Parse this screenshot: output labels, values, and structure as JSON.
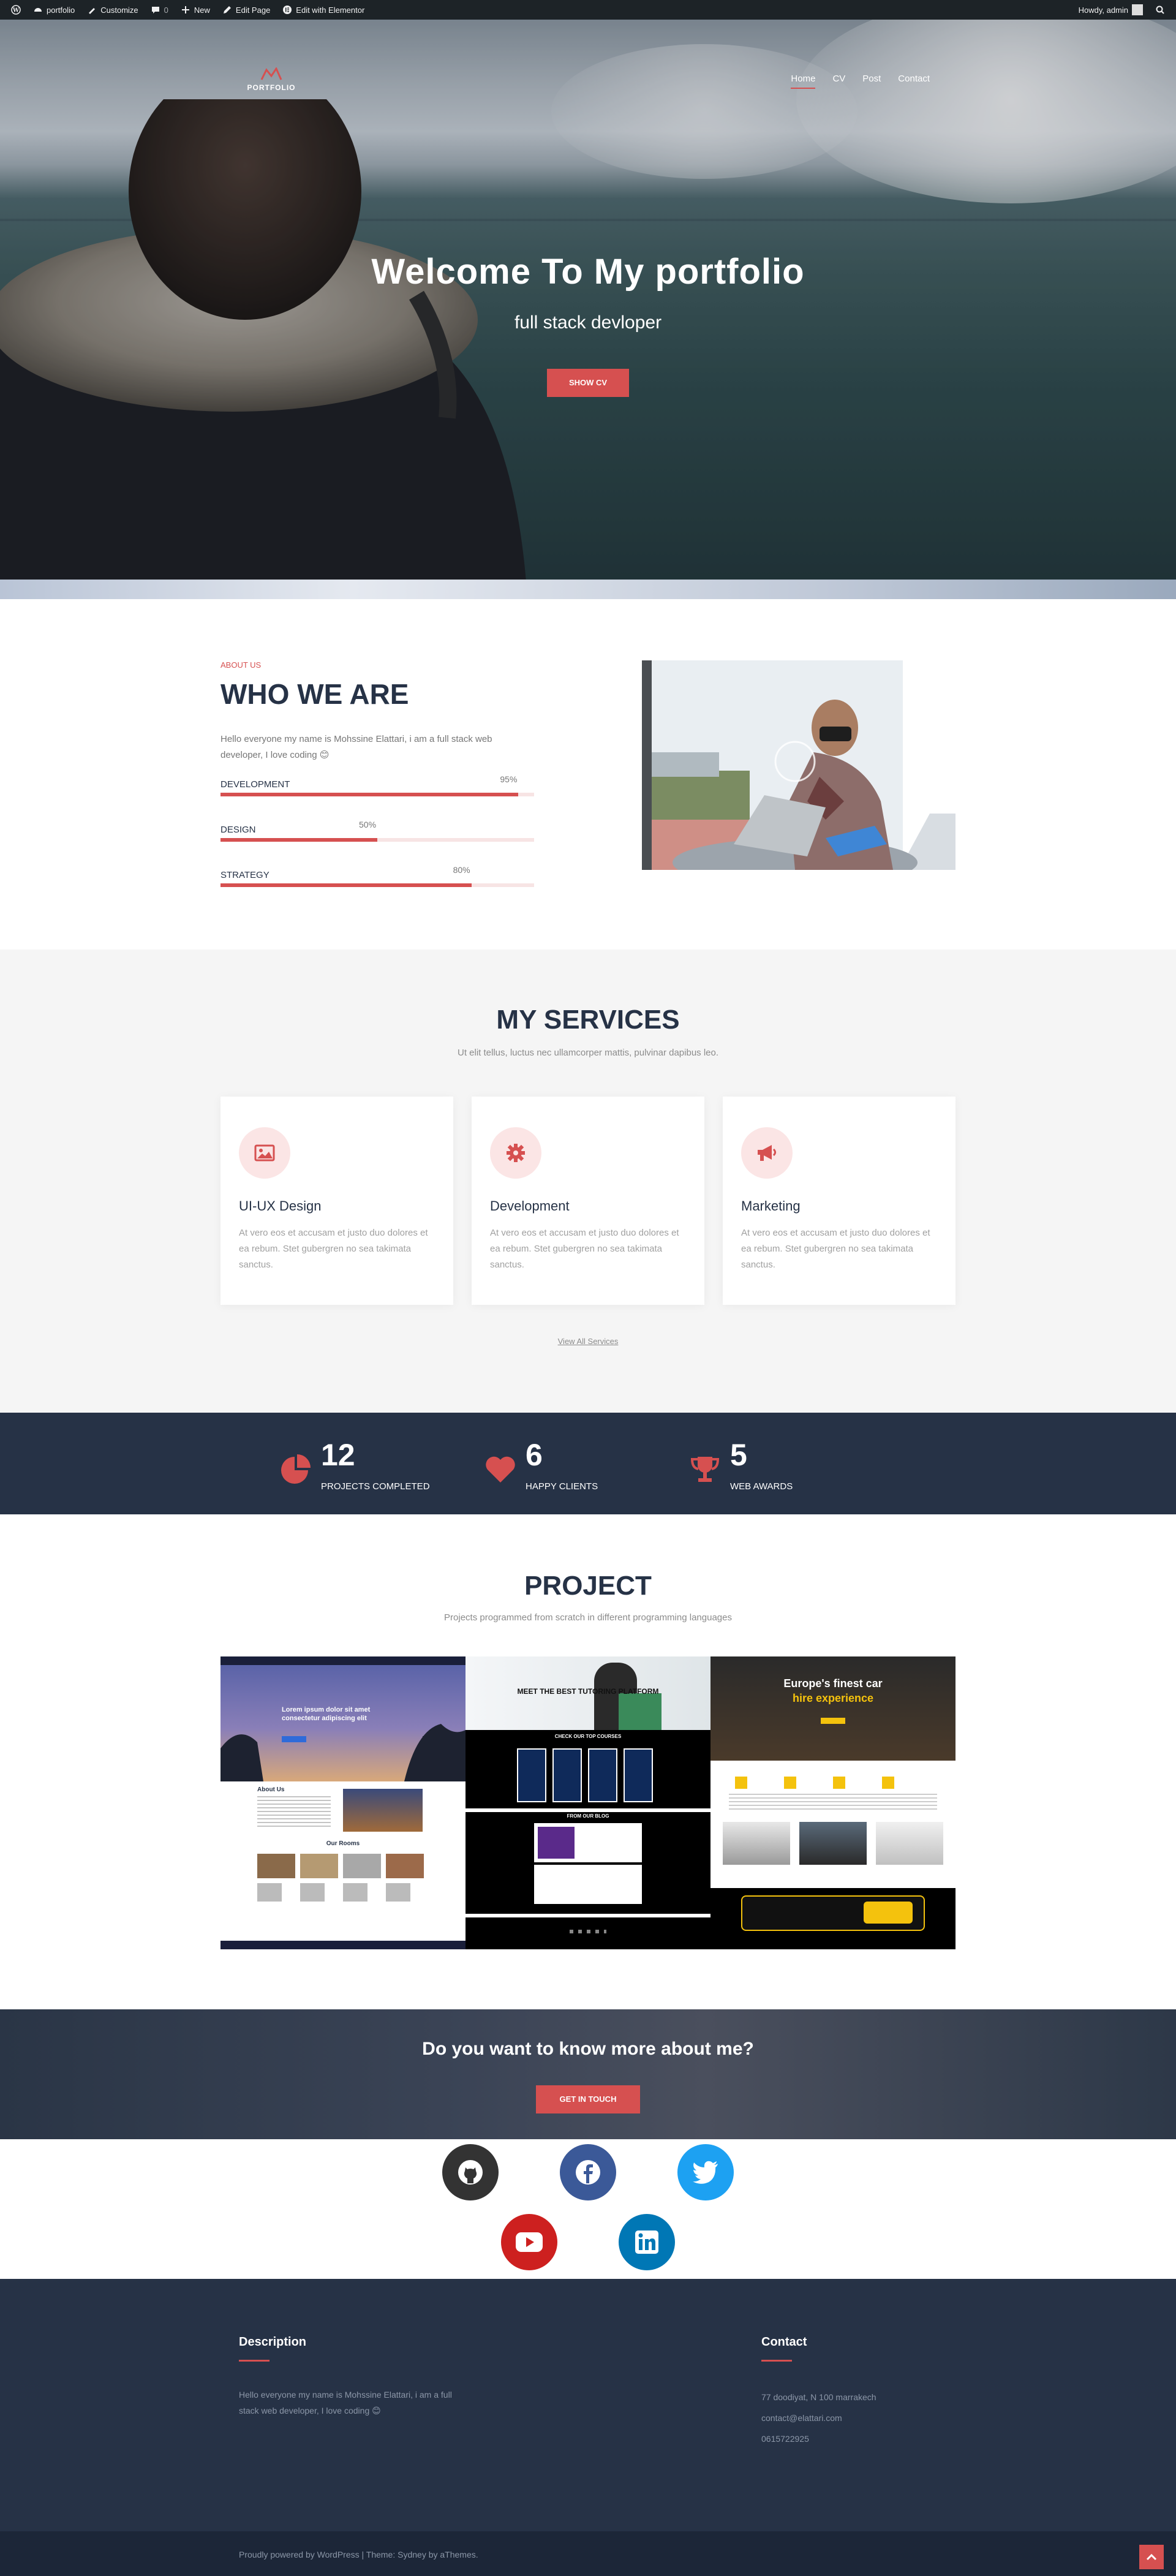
{
  "admin_bar": {
    "site_name": "portfolio",
    "customize": "Customize",
    "comments_count": "0",
    "new": "New",
    "edit_page": "Edit Page",
    "edit_elementor": "Edit with Elementor",
    "howdy": "Howdy, admin"
  },
  "header": {
    "logo_text": "PORTFOLIO",
    "nav": [
      "Home",
      "CV",
      "Post",
      "Contact"
    ]
  },
  "hero": {
    "title": "Welcome To My portfolio",
    "subtitle": "full stack devloper",
    "button": "SHOW CV"
  },
  "about": {
    "eyebrow": "ABOUT US",
    "title": "WHO WE ARE",
    "text": "Hello everyone my name is Mohssine Elattari, i am a full stack web developer, I love coding 😊",
    "skills": [
      {
        "label": "DEVELOPMENT",
        "pct_text": "95%",
        "value": 0.95
      },
      {
        "label": "DESIGN",
        "pct_text": "50%",
        "value": 0.5
      },
      {
        "label": "STRATEGY",
        "pct_text": "80%",
        "value": 0.8
      }
    ]
  },
  "services": {
    "title": "MY SERVICES",
    "subtitle": "Ut elit tellus, luctus nec ullamcorper mattis, pulvinar dapibus leo.",
    "items": [
      {
        "name": "UI-UX Design",
        "icon": "image-icon",
        "desc": "At vero eos et accusam et justo duo dolores et ea rebum. Stet gubergren no sea takimata sanctus."
      },
      {
        "name": "Development",
        "icon": "gear-icon",
        "desc": "At vero eos et accusam et justo duo dolores et ea rebum. Stet gubergren no sea takimata sanctus."
      },
      {
        "name": "Marketing",
        "icon": "megaphone-icon",
        "desc": "At vero eos et accusam et justo duo dolores et ea rebum. Stet gubergren no sea takimata sanctus."
      }
    ],
    "view_all": "View All Services"
  },
  "stats": [
    {
      "number": "12",
      "label": "PROJECTS COMPLETED",
      "icon": "pie-chart-icon"
    },
    {
      "number": "6",
      "label": "HAPPY CLIENTS",
      "icon": "heart-icon"
    },
    {
      "number": "5",
      "label": "WEB AWARDS",
      "icon": "trophy-icon"
    }
  ],
  "project": {
    "title": "PROJECT",
    "subtitle": "Projects programmed from scratch in different programming languages",
    "panel1": {
      "headline": "Lorem ipsum dolor sit amet consectetur adipiscing elit",
      "about": "About Us",
      "rooms": "Our Rooms"
    },
    "panel2": {
      "headline": "MEET THE BEST TUTORING PLATFORM",
      "courses": "CHECK OUR TOP COURSES",
      "blog": "FROM OUR BLOG"
    },
    "panel3": {
      "headline1": "Europe's finest car",
      "headline2": "hire experience"
    }
  },
  "cta": {
    "title": "Do you want to know more about me?",
    "button": "GET IN TOUCH"
  },
  "social": [
    "github-icon",
    "facebook-icon",
    "twitter-icon",
    "youtube-icon",
    "linkedin-icon"
  ],
  "footer": {
    "description_title": "Description",
    "description_text": "Hello everyone my name is Mohssine Elattari, i am a full stack web developer, I love coding 😊",
    "contact_title": "Contact",
    "contact_lines": [
      "77 doodiyat, N 100 marrakech",
      "contact@elattari.com",
      "0615722925"
    ],
    "credits": "Proudly powered by WordPress | Theme: Sydney by aThemes."
  },
  "colors": {
    "accent": "#d65050",
    "dark": "#263246",
    "github": "#333333",
    "facebook": "#3b5998",
    "twitter": "#1da1f2",
    "youtube": "#cd201f",
    "linkedin": "#0077b5"
  }
}
